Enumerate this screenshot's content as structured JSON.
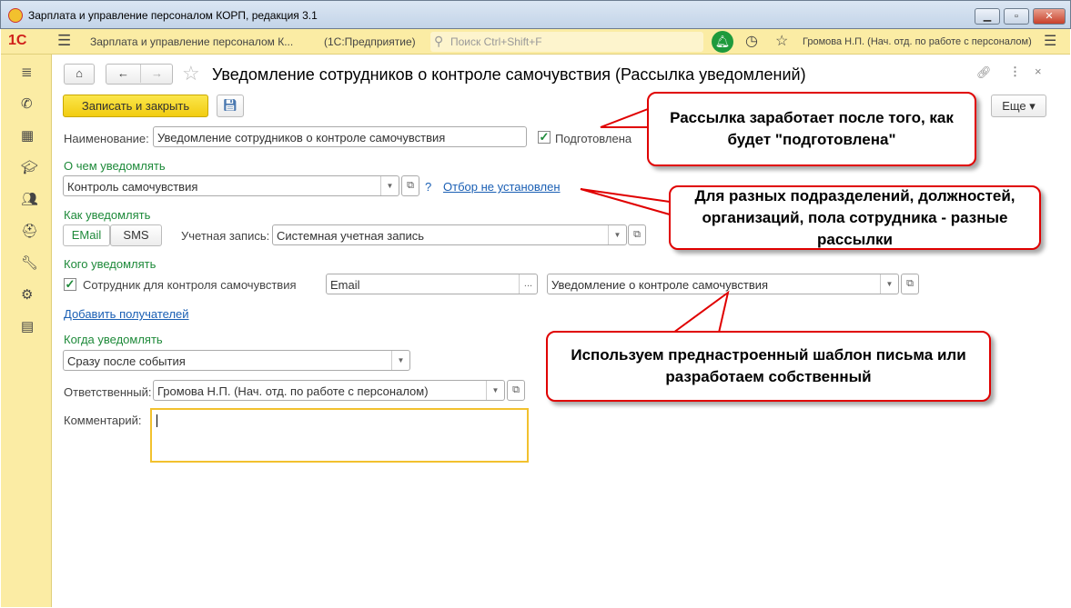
{
  "window": {
    "title": "Зарплата и управление персоналом КОРП, редакция 3.1"
  },
  "toolbar": {
    "app_name": "Зарплата и управление персоналом К...",
    "platform": "(1С:Предприятие)",
    "search_placeholder": "Поиск Ctrl+Shift+F",
    "user": "Громова Н.П. (Нач. отд. по работе с персоналом)"
  },
  "form": {
    "title": "Уведомление сотрудников о контроле самочувствия (Рассылка уведомлений)",
    "save_close": "Записать и закрыть",
    "more": "Еще",
    "name_label": "Наименование:",
    "name_value": "Уведомление сотрудников о контроле самочувствия",
    "prepared_label": "Подготовлена",
    "prepared": true,
    "what_group": "О чем уведомлять",
    "what_value": "Контроль самочувствия",
    "help": "?",
    "filter_link": "Отбор не установлен",
    "how_group": "Как уведомлять",
    "tab_email": "EMail",
    "tab_sms": "SMS",
    "account_label": "Учетная запись:",
    "account_value": "Системная учетная запись",
    "who_group": "Кого уведомлять",
    "recipient_label": "Сотрудник для контроля самочувствия",
    "recipient_checked": true,
    "contact_value": "Email",
    "contact_btn": "...",
    "template_value": "Уведомление о контроле самочувствия",
    "add_recipients": "Добавить получателей",
    "when_group": "Когда уведомлять",
    "when_value": "Сразу после события",
    "responsible_label": "Ответственный:",
    "responsible_value": "Громова Н.П. (Нач. отд. по работе с персоналом)",
    "comment_label": "Комментарий:",
    "comment_value": ""
  },
  "callouts": [
    "Рассылка заработает после того, как будет \"подготовлена\"",
    "Для разных подразделений, должностей, организаций, пола сотрудника - разные рассылки",
    "Используем преднастроенный шаблон письма или разработаем собственный"
  ],
  "colors": {
    "accent_yellow": "#fbeca4",
    "button_yellow": "#f5d321",
    "group_green": "#1e8a3a",
    "callout_red": "#e00000"
  }
}
